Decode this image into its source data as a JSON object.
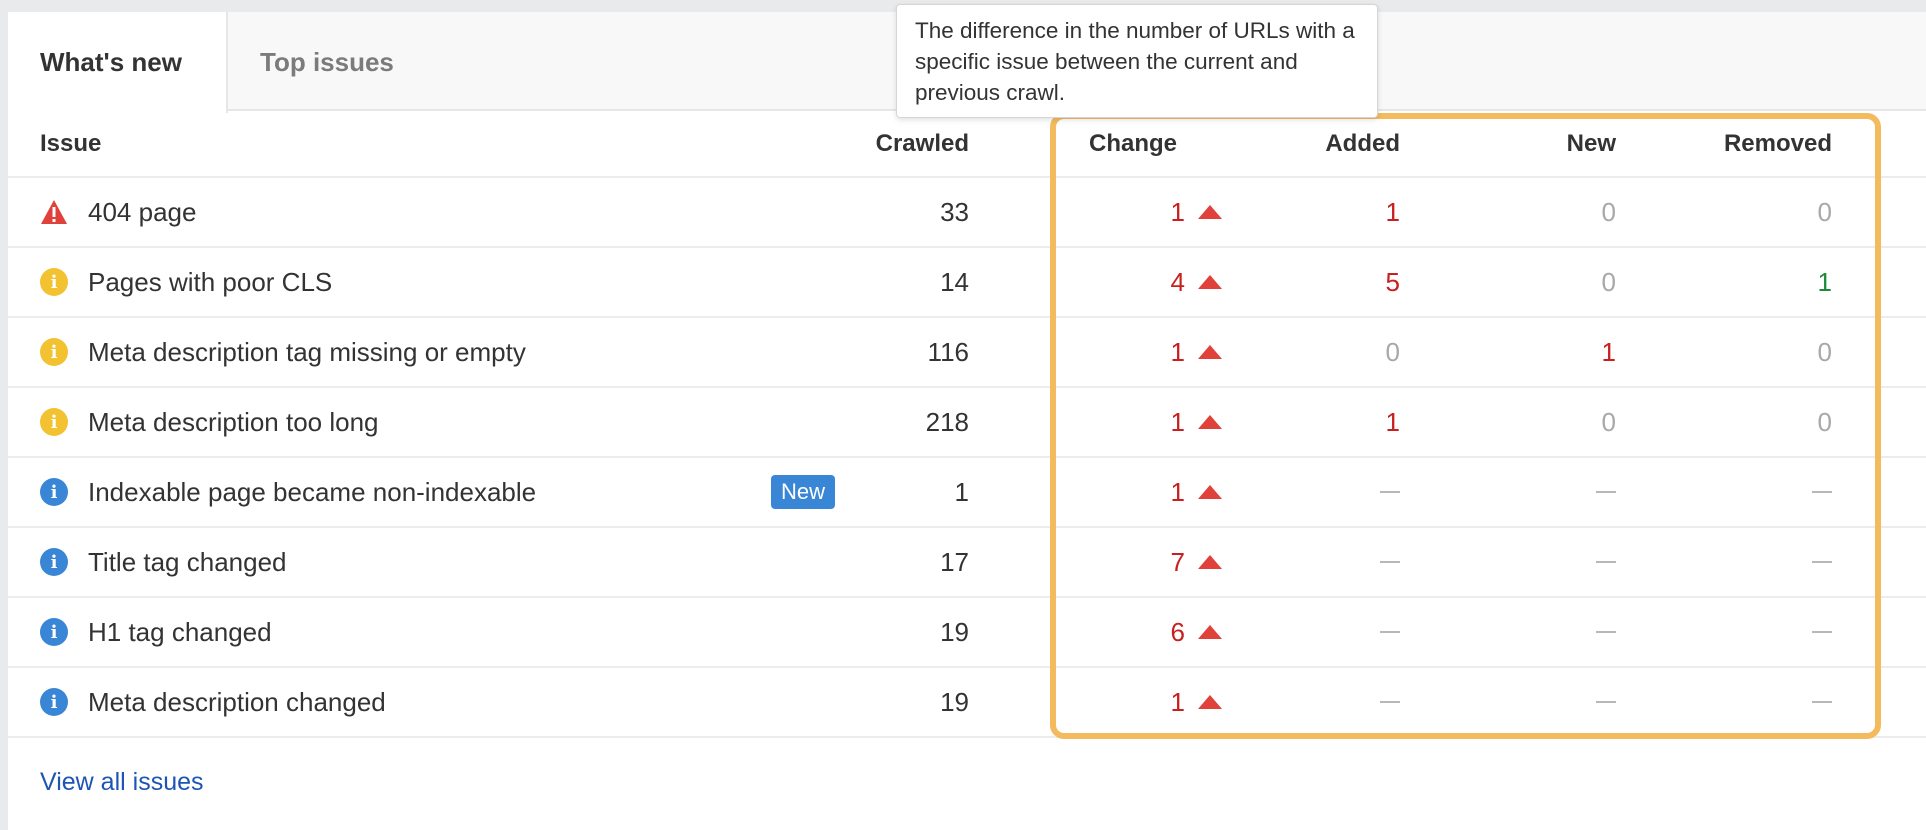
{
  "tabs": [
    {
      "label": "What's new",
      "active": true
    },
    {
      "label": "Top issues",
      "active": false
    }
  ],
  "tooltip": {
    "text": "The difference in the number of URLs with a specific issue between the current and previous crawl."
  },
  "columns": {
    "issue": "Issue",
    "crawled": "Crawled",
    "change": "Change",
    "added": "Added",
    "new": "New",
    "removed": "Removed"
  },
  "rows": [
    {
      "icon": "error-triangle-icon",
      "issue": "404 page",
      "badge": null,
      "crawled": "33",
      "change": "1",
      "added": "1",
      "new": "0",
      "removed": "0"
    },
    {
      "icon": "warning-info-icon",
      "issue": "Pages with poor CLS",
      "badge": null,
      "crawled": "14",
      "change": "4",
      "added": "5",
      "new": "0",
      "removed": "1"
    },
    {
      "icon": "warning-info-icon",
      "issue": "Meta description tag missing or empty",
      "badge": null,
      "crawled": "116",
      "change": "1",
      "added": "0",
      "new": "1",
      "removed": "0"
    },
    {
      "icon": "warning-info-icon",
      "issue": "Meta description too long",
      "badge": null,
      "crawled": "218",
      "change": "1",
      "added": "1",
      "new": "0",
      "removed": "0"
    },
    {
      "icon": "notice-info-icon",
      "issue": "Indexable page became non-indexable",
      "badge": "New",
      "crawled": "1",
      "change": "1",
      "added": "—",
      "new": "—",
      "removed": "—"
    },
    {
      "icon": "notice-info-icon",
      "issue": "Title tag changed",
      "badge": null,
      "crawled": "17",
      "change": "7",
      "added": "—",
      "new": "—",
      "removed": "—"
    },
    {
      "icon": "notice-info-icon",
      "issue": "H1 tag changed",
      "badge": null,
      "crawled": "19",
      "change": "6",
      "added": "—",
      "new": "—",
      "removed": "—"
    },
    {
      "icon": "notice-info-icon",
      "issue": "Meta description changed",
      "badge": null,
      "crawled": "19",
      "change": "1",
      "added": "—",
      "new": "—",
      "removed": "—"
    }
  ],
  "footer": {
    "link": "View all issues"
  },
  "colors": {
    "error": "#e0413a",
    "warning": "#f2c230",
    "notice": "#3a86d6",
    "highlight": "#f3bb5e",
    "increase": "#c8201e",
    "decrease": "#1e8a3a"
  }
}
